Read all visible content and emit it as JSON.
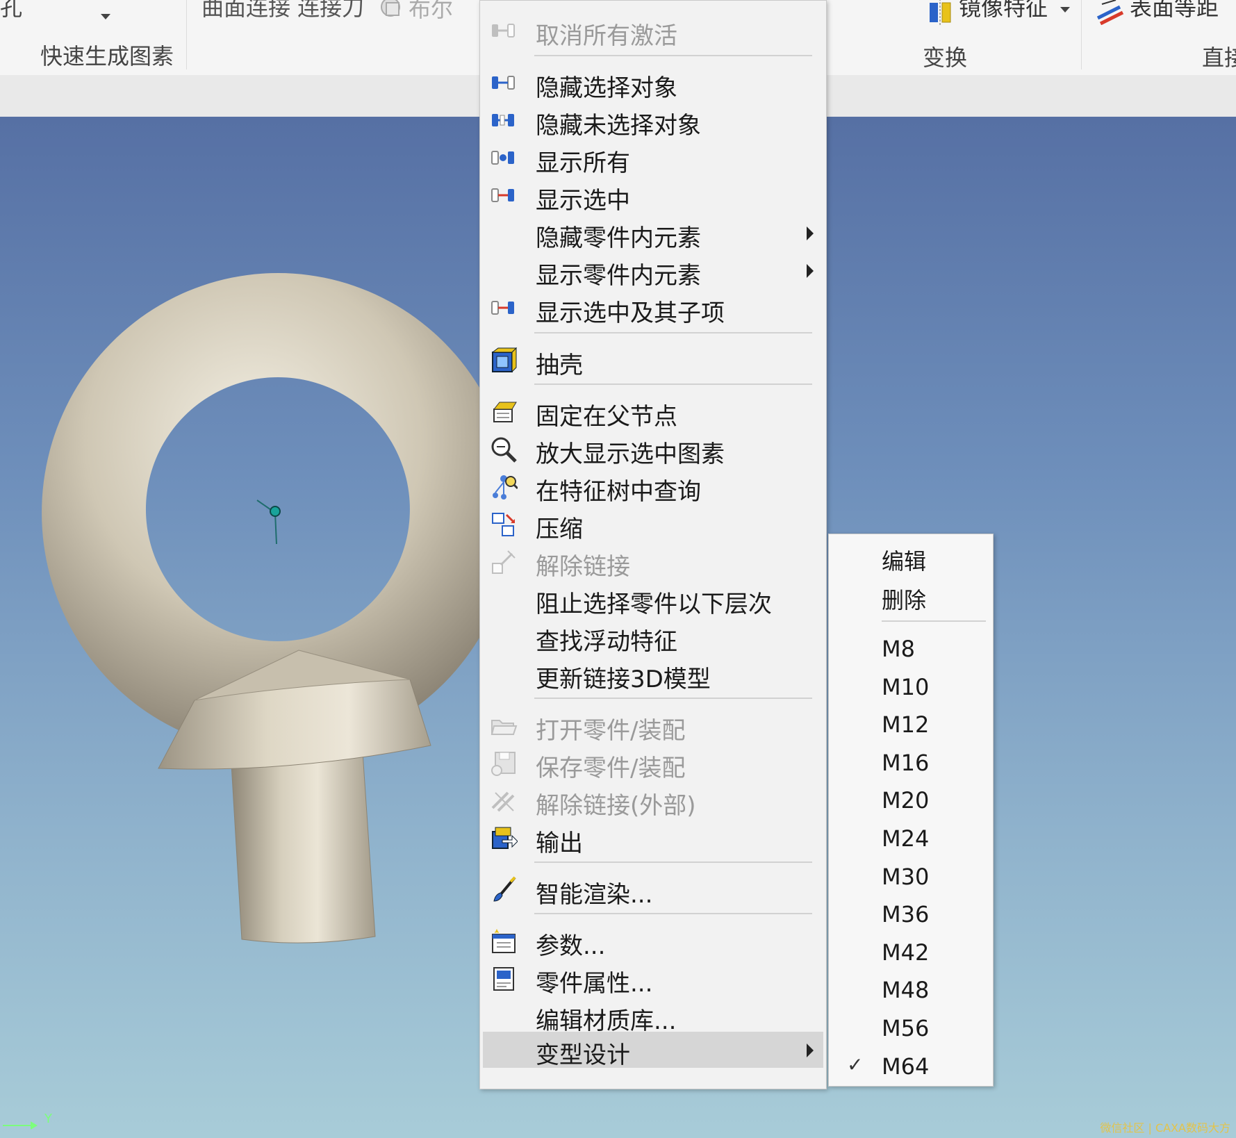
{
  "ribbon": {
    "top_fragment_left": "孔",
    "top_fragment_mid": "曲面连接 连接刀",
    "boolean_label": "布尔",
    "group_quick": "快速生成图素",
    "mirror_label": "镜像特征",
    "surface_offset_label": "表面等距",
    "group_transform": "变换",
    "group_direct": "直接"
  },
  "context_menu": {
    "items": [
      {
        "label": "取消所有激活",
        "icon": "deactivate-icon",
        "disabled": true
      },
      {
        "label": "隐藏选择对象",
        "icon": "hide-selected-icon",
        "disabled": false
      },
      {
        "label": "隐藏未选择对象",
        "icon": "hide-unselected-icon",
        "disabled": false
      },
      {
        "label": "显示所有",
        "icon": "show-all-icon",
        "disabled": false
      },
      {
        "label": "显示选中",
        "icon": "show-selected-icon",
        "disabled": false
      },
      {
        "label": "隐藏零件内元素",
        "icon": "",
        "disabled": false,
        "submenu": true
      },
      {
        "label": "显示零件内元素",
        "icon": "",
        "disabled": false,
        "submenu": true
      },
      {
        "label": "显示选中及其子项",
        "icon": "show-children-icon",
        "disabled": false
      },
      {
        "label": "抽壳",
        "icon": "shell-icon",
        "disabled": false
      },
      {
        "label": "固定在父节点",
        "icon": "pin-parent-icon",
        "disabled": false
      },
      {
        "label": "放大显示选中图素",
        "icon": "zoom-selected-icon",
        "disabled": false
      },
      {
        "label": "在特征树中查询",
        "icon": "tree-search-icon",
        "disabled": false
      },
      {
        "label": "压缩",
        "icon": "suppress-icon",
        "disabled": false
      },
      {
        "label": "解除链接",
        "icon": "unlink-icon",
        "disabled": true
      },
      {
        "label": "阻止选择零件以下层次",
        "icon": "",
        "disabled": false
      },
      {
        "label": "查找浮动特征",
        "icon": "",
        "disabled": false
      },
      {
        "label": "更新链接3D模型",
        "icon": "",
        "disabled": false
      },
      {
        "label": "打开零件/装配",
        "icon": "open-folder-icon",
        "disabled": true
      },
      {
        "label": "保存零件/装配",
        "icon": "save-part-icon",
        "disabled": true
      },
      {
        "label": "解除链接(外部)",
        "icon": "unlink-external-icon",
        "disabled": true
      },
      {
        "label": "输出",
        "icon": "export-icon",
        "disabled": false
      },
      {
        "label": "智能渲染...",
        "icon": "render-brush-icon",
        "disabled": false
      },
      {
        "label": "参数...",
        "icon": "parameters-icon",
        "disabled": false
      },
      {
        "label": "零件属性...",
        "icon": "part-properties-icon",
        "disabled": false
      },
      {
        "label": "编辑材质库...",
        "icon": "",
        "disabled": false
      },
      {
        "label": "变型设计",
        "icon": "",
        "disabled": false,
        "submenu": true,
        "highlight": true
      }
    ]
  },
  "submenu": {
    "edit_label": "编辑",
    "delete_label": "删除",
    "sizes": [
      "M8",
      "M10",
      "M12",
      "M16",
      "M20",
      "M24",
      "M30",
      "M36",
      "M42",
      "M48",
      "M56",
      "M64"
    ],
    "checked": "M64",
    "check_mark": "✓"
  },
  "viewport": {
    "axis_y_label": "Y",
    "watermark": "微信社区 | CAXA数码大方"
  }
}
